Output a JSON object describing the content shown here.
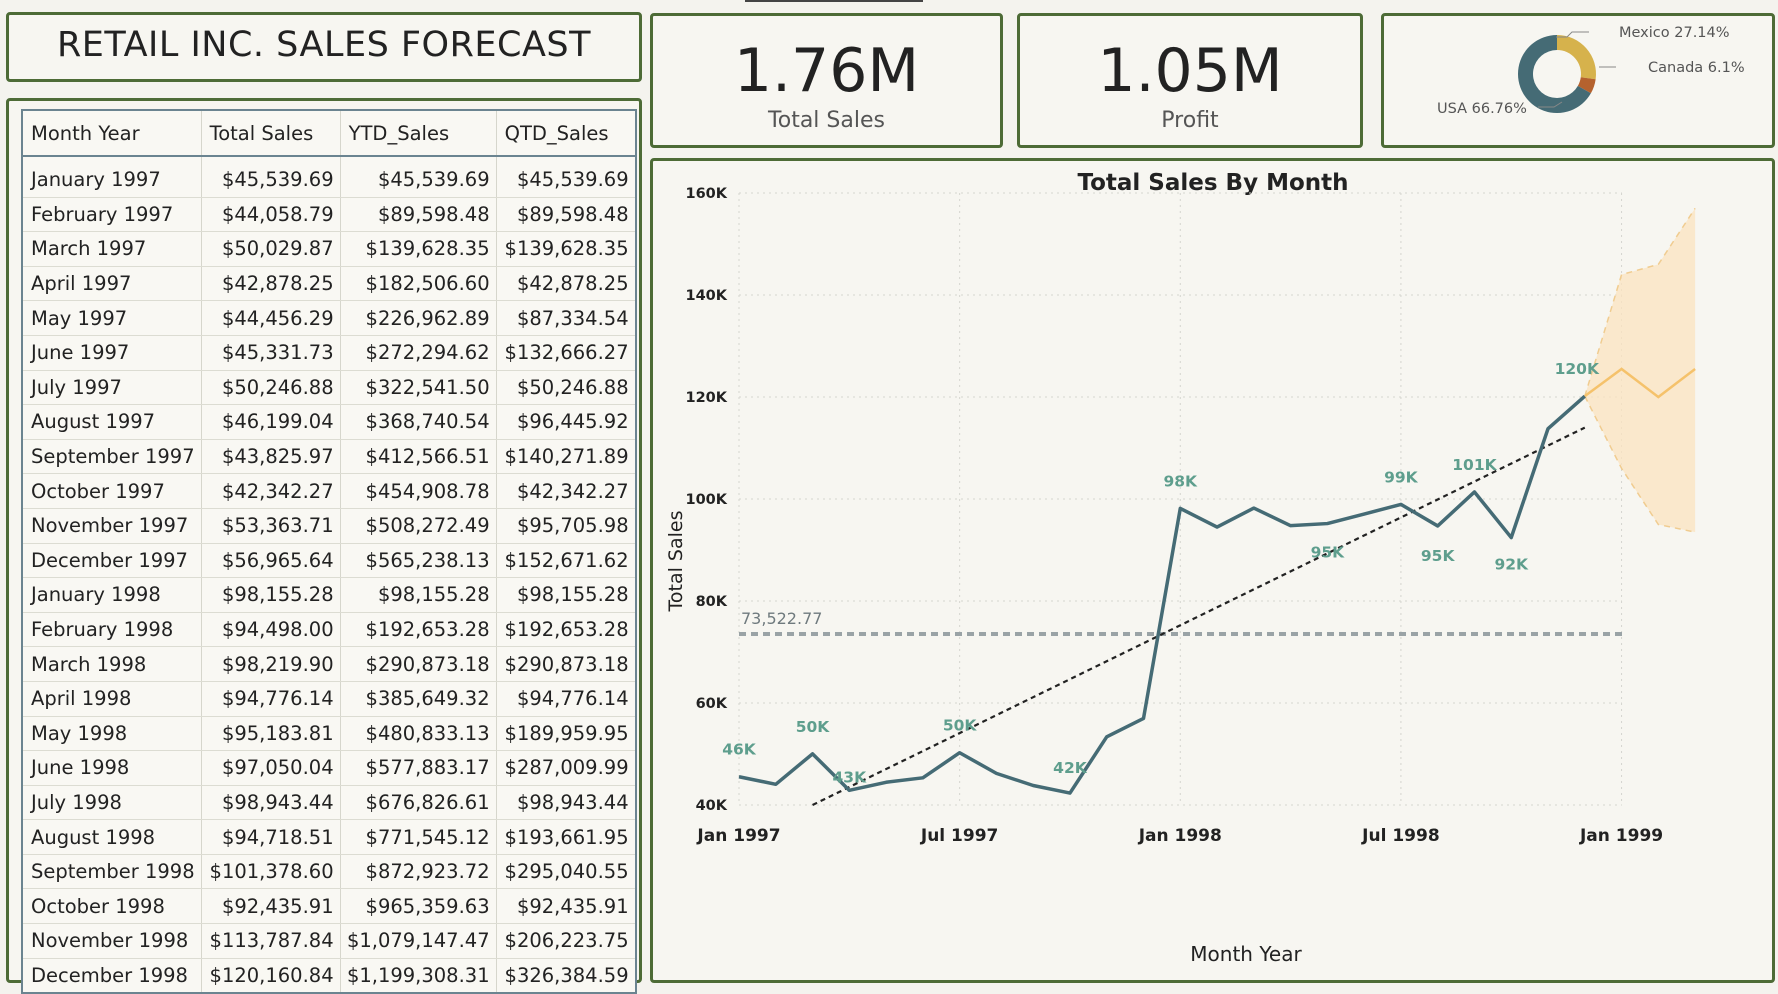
{
  "title": "RETAIL INC.  SALES FORECAST",
  "kpis": {
    "total_sales": {
      "value": "1.76M",
      "label": "Total Sales"
    },
    "profit": {
      "value": "1.05M",
      "label": "Profit"
    }
  },
  "donut": {
    "colors": {
      "USA": "#456b75",
      "Mexico": "#d6b24c",
      "Canada": "#b5622e"
    },
    "slices": [
      {
        "label": "USA",
        "pct": 66.76,
        "text": "USA 66.76%"
      },
      {
        "label": "Mexico",
        "pct": 27.14,
        "text": "Mexico 27.14%"
      },
      {
        "label": "Canada",
        "pct": 6.1,
        "text": "Canada 6.1%"
      }
    ]
  },
  "table": {
    "headers": [
      "Month Year",
      "Total Sales",
      "YTD_Sales",
      "QTD_Sales"
    ],
    "rows": [
      [
        "January 1997",
        "$45,539.69",
        "$45,539.69",
        "$45,539.69"
      ],
      [
        "February 1997",
        "$44,058.79",
        "$89,598.48",
        "$89,598.48"
      ],
      [
        "March 1997",
        "$50,029.87",
        "$139,628.35",
        "$139,628.35"
      ],
      [
        "April 1997",
        "$42,878.25",
        "$182,506.60",
        "$42,878.25"
      ],
      [
        "May 1997",
        "$44,456.29",
        "$226,962.89",
        "$87,334.54"
      ],
      [
        "June 1997",
        "$45,331.73",
        "$272,294.62",
        "$132,666.27"
      ],
      [
        "July 1997",
        "$50,246.88",
        "$322,541.50",
        "$50,246.88"
      ],
      [
        "August 1997",
        "$46,199.04",
        "$368,740.54",
        "$96,445.92"
      ],
      [
        "September 1997",
        "$43,825.97",
        "$412,566.51",
        "$140,271.89"
      ],
      [
        "October 1997",
        "$42,342.27",
        "$454,908.78",
        "$42,342.27"
      ],
      [
        "November 1997",
        "$53,363.71",
        "$508,272.49",
        "$95,705.98"
      ],
      [
        "December 1997",
        "$56,965.64",
        "$565,238.13",
        "$152,671.62"
      ],
      [
        "January 1998",
        "$98,155.28",
        "$98,155.28",
        "$98,155.28"
      ],
      [
        "February 1998",
        "$94,498.00",
        "$192,653.28",
        "$192,653.28"
      ],
      [
        "March 1998",
        "$98,219.90",
        "$290,873.18",
        "$290,873.18"
      ],
      [
        "April 1998",
        "$94,776.14",
        "$385,649.32",
        "$94,776.14"
      ],
      [
        "May 1998",
        "$95,183.81",
        "$480,833.13",
        "$189,959.95"
      ],
      [
        "June 1998",
        "$97,050.04",
        "$577,883.17",
        "$287,009.99"
      ],
      [
        "July 1998",
        "$98,943.44",
        "$676,826.61",
        "$98,943.44"
      ],
      [
        "August 1998",
        "$94,718.51",
        "$771,545.12",
        "$193,661.95"
      ],
      [
        "September 1998",
        "$101,378.60",
        "$872,923.72",
        "$295,040.55"
      ],
      [
        "October 1998",
        "$92,435.91",
        "$965,359.63",
        "$92,435.91"
      ],
      [
        "November 1998",
        "$113,787.84",
        "$1,079,147.47",
        "$206,223.75"
      ],
      [
        "December 1998",
        "$120,160.84",
        "$1,199,308.31",
        "$326,384.59"
      ]
    ]
  },
  "chart_data": {
    "type": "line",
    "title": "Total Sales By Month",
    "xlabel": "Month Year",
    "ylabel": "Total Sales",
    "ylim": [
      40000,
      160000
    ],
    "yticks": [
      40000,
      60000,
      80000,
      100000,
      120000,
      140000,
      160000
    ],
    "ytick_labels": [
      "40K",
      "60K",
      "80K",
      "100K",
      "120K",
      "140K",
      "160K"
    ],
    "xticks": [
      "1997-01",
      "1997-07",
      "1998-01",
      "1998-07",
      "1999-01"
    ],
    "xtick_labels": [
      "Jan 1997",
      "Jul 1997",
      "Jan 1998",
      "Jul 1998",
      "Jan 1999"
    ],
    "grid": true,
    "x": [
      "1997-01",
      "1997-02",
      "1997-03",
      "1997-04",
      "1997-05",
      "1997-06",
      "1997-07",
      "1997-08",
      "1997-09",
      "1997-10",
      "1997-11",
      "1997-12",
      "1998-01",
      "1998-02",
      "1998-03",
      "1998-04",
      "1998-05",
      "1998-06",
      "1998-07",
      "1998-08",
      "1998-09",
      "1998-10",
      "1998-11",
      "1998-12"
    ],
    "values": [
      45539.69,
      44058.79,
      50029.87,
      42878.25,
      44456.29,
      45331.73,
      50246.88,
      46199.04,
      43825.97,
      42342.27,
      53363.71,
      56965.64,
      98155.28,
      94498.0,
      98219.9,
      94776.14,
      95183.81,
      97050.04,
      98943.44,
      94718.51,
      101378.6,
      92435.91,
      113787.84,
      120160.84
    ],
    "line_color": "#456b75",
    "data_labels": [
      {
        "x": "1997-01",
        "value": 45539.69,
        "text": "46K"
      },
      {
        "x": "1997-03",
        "value": 50029.87,
        "text": "50K"
      },
      {
        "x": "1997-04",
        "value": 42878.25,
        "text": "43K"
      },
      {
        "x": "1997-07",
        "value": 50246.88,
        "text": "50K"
      },
      {
        "x": "1997-10",
        "value": 42342.27,
        "text": "42K"
      },
      {
        "x": "1998-01",
        "value": 98155.28,
        "text": "98K"
      },
      {
        "x": "1998-05",
        "value": 95183.81,
        "text": "95K"
      },
      {
        "x": "1998-07",
        "value": 98943.44,
        "text": "99K"
      },
      {
        "x": "1998-08",
        "value": 94718.51,
        "text": "95K"
      },
      {
        "x": "1998-09",
        "value": 101378.6,
        "text": "101K"
      },
      {
        "x": "1998-10",
        "value": 92435.91,
        "text": "92K"
      },
      {
        "x": "1998-12",
        "value": 120160.84,
        "text": "120K"
      }
    ],
    "forecast": {
      "color": "#f5c26b",
      "band_color": "#fbe3bf",
      "x": [
        "1998-12",
        "1999-01",
        "1999-02",
        "1999-03"
      ],
      "values": [
        120160.84,
        125500,
        120000,
        125500
      ],
      "upper": [
        120160.84,
        144000,
        146000,
        157000
      ],
      "lower": [
        120160.84,
        106000,
        95000,
        93500
      ]
    },
    "trend": {
      "x": [
        "1997-03",
        "1998-12"
      ],
      "values": [
        40000,
        114000
      ]
    },
    "average": {
      "value": 73522.77,
      "label": "73,522.77",
      "color": "#9aa3a6"
    }
  }
}
